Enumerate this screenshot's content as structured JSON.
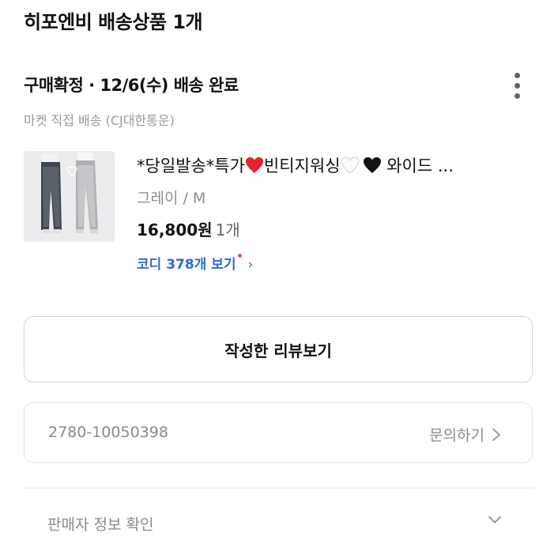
{
  "header": {
    "store_title": "히포엔비 배송상품 1개"
  },
  "order": {
    "status": "구매확정 · 12/6(수) 배송 완료",
    "shipping_note": "마켓 직접 배송 (CJ대한통운)",
    "order_number": "2780-10050398",
    "inquiry_label": "문의하기"
  },
  "product": {
    "name_part1": "*당일발송*특가",
    "name_part2": "빈티지워싱",
    "name_part3": "와이드 ...",
    "option": "그레이 / M",
    "price": "16,800원",
    "quantity": "1개",
    "coordi_label": "코디 378개 보기"
  },
  "actions": {
    "review_button": "작성한 리뷰보기"
  },
  "seller": {
    "info_label": "판매자 정보 확인"
  },
  "icons": {
    "more": "more-vertical-icon",
    "chevron_right": "chevron-right-icon",
    "chevron_down": "chevron-down-icon",
    "red_heart": "red-heart-emoji",
    "white_heart": "white-heart-emoji",
    "black_heart": "black-heart-emoji"
  },
  "colors": {
    "accent_blue": "#2d6bd1",
    "notification_dot": "#f04f6f",
    "red_heart": "#e3242b"
  }
}
